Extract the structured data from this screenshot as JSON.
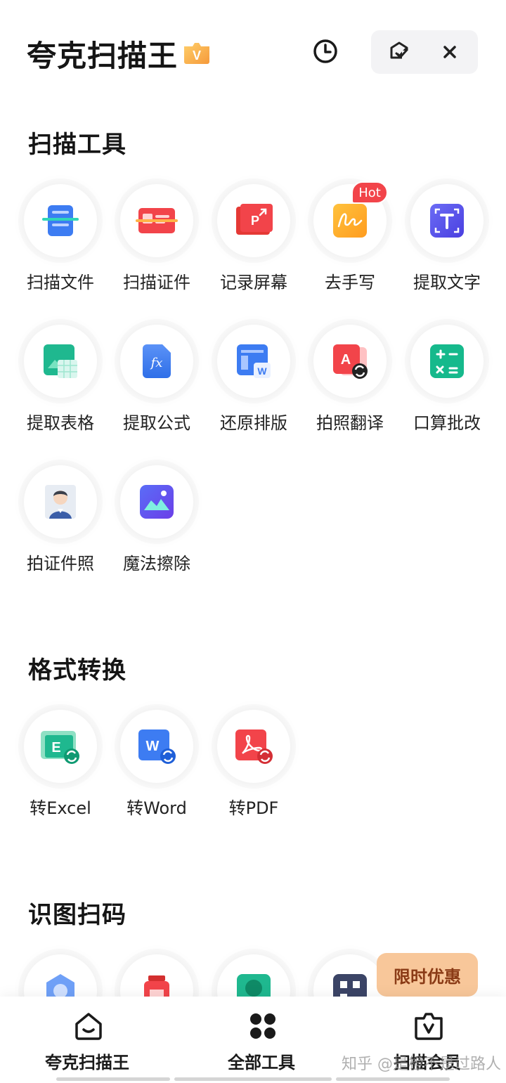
{
  "header": {
    "title": "夸克扫描王",
    "vip_letter": "V"
  },
  "sections": {
    "scan": {
      "title": "扫描工具",
      "tools": [
        {
          "label": "扫描文件",
          "icon": "scan-file-icon"
        },
        {
          "label": "扫描证件",
          "icon": "scan-id-icon"
        },
        {
          "label": "记录屏幕",
          "icon": "record-screen-icon"
        },
        {
          "label": "去手写",
          "icon": "remove-handwriting-icon",
          "badge": "Hot"
        },
        {
          "label": "提取文字",
          "icon": "extract-text-icon"
        },
        {
          "label": "提取表格",
          "icon": "extract-table-icon"
        },
        {
          "label": "提取公式",
          "icon": "extract-formula-icon",
          "glyph": "fx"
        },
        {
          "label": "还原排版",
          "icon": "restore-layout-icon",
          "glyph": "W"
        },
        {
          "label": "拍照翻译",
          "icon": "photo-translate-icon",
          "glyph": "A"
        },
        {
          "label": "口算批改",
          "icon": "math-check-icon"
        },
        {
          "label": "拍证件照",
          "icon": "id-photo-icon"
        },
        {
          "label": "魔法擦除",
          "icon": "magic-erase-icon"
        }
      ]
    },
    "convert": {
      "title": "格式转换",
      "tools": [
        {
          "label": "转Excel",
          "icon": "to-excel-icon",
          "glyph": "E"
        },
        {
          "label": "转Word",
          "icon": "to-word-icon",
          "glyph": "W"
        },
        {
          "label": "转PDF",
          "icon": "to-pdf-icon"
        }
      ]
    },
    "recognize": {
      "title": "识图扫码"
    }
  },
  "promo": {
    "label": "限时优惠"
  },
  "bottom_nav": {
    "items": [
      {
        "label": "夸克扫描王",
        "icon": "home-icon"
      },
      {
        "label": "全部工具",
        "icon": "all-tools-icon"
      },
      {
        "label": "扫描会员",
        "icon": "vip-bag-icon"
      }
    ]
  },
  "watermark": "知乎 @是橙不是过路人",
  "colors": {
    "accent_blue": "#3d7cf2",
    "accent_red": "#f2444a",
    "accent_green": "#1fb88f",
    "promo_bg": "#f8c79a",
    "vip_orange": "#f5a53c"
  }
}
